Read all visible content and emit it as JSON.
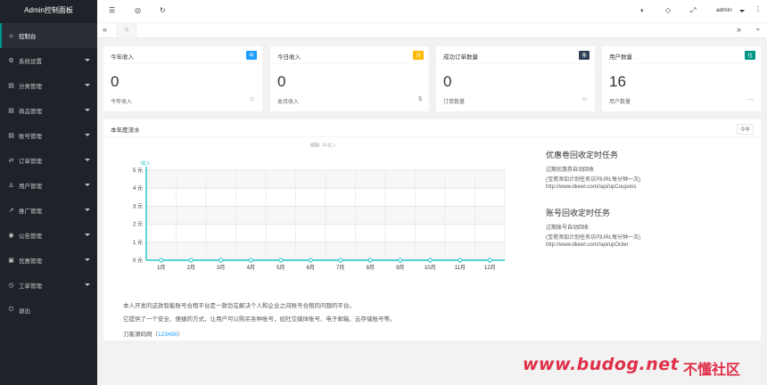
{
  "app_title": "Admin控制面板",
  "sidebar": {
    "items": [
      {
        "icon": "⌂",
        "label": "控制台",
        "caret": false
      },
      {
        "icon": "⚙",
        "label": "系统设置",
        "caret": true
      },
      {
        "icon": "▤",
        "label": "分类管理",
        "caret": true
      },
      {
        "icon": "▤",
        "label": "商品管理",
        "caret": true
      },
      {
        "icon": "▤",
        "label": "账号管理",
        "caret": true
      },
      {
        "icon": "⇄",
        "label": "订单管理",
        "caret": true
      },
      {
        "icon": "♙",
        "label": "用户管理",
        "caret": true
      },
      {
        "icon": "↗",
        "label": "推广管理",
        "caret": true
      },
      {
        "icon": "◉",
        "label": "公告管理",
        "caret": true
      },
      {
        "icon": "▣",
        "label": "优惠管理",
        "caret": true
      },
      {
        "icon": "◷",
        "label": "工单管理",
        "caret": true
      },
      {
        "icon": "⏻",
        "label": "退出",
        "caret": false
      }
    ]
  },
  "header": {
    "icons": [
      "menu-fold-icon",
      "globe-icon",
      "refresh-icon",
      "theme-icon",
      "tag-icon",
      "fullscreen-icon"
    ],
    "user": "admin",
    "more": "⋮"
  },
  "tabs": {
    "prev": "«",
    "next": "»",
    "dropdown": "⌄",
    "home_icon": "⌂"
  },
  "cards": [
    {
      "title": "今年收入",
      "badge": "年",
      "badge_color": "#1e9fff",
      "value": "0",
      "sub": "今年收入",
      "icon": "⚐"
    },
    {
      "title": "今日收入",
      "badge": "月",
      "badge_color": "#ffb800",
      "value": "0",
      "sub": "本月收入",
      "icon": "$"
    },
    {
      "title": "成功订单数量",
      "badge": "条",
      "badge_color": "#2f4056",
      "value": "0",
      "sub": "订单数量",
      "icon": "☺"
    },
    {
      "title": "用户数量",
      "badge": "位",
      "badge_color": "#009688",
      "value": "16",
      "sub": "用户数量",
      "icon": "⋯"
    }
  ],
  "panel": {
    "title": "本年度流水",
    "year_button": "今年"
  },
  "chart_data": {
    "type": "line",
    "legend": "年收入",
    "series_label": "收入",
    "categories": [
      "1月",
      "2月",
      "3月",
      "4月",
      "5月",
      "6月",
      "7月",
      "8月",
      "9月",
      "10月",
      "11月",
      "12月"
    ],
    "values": [
      0,
      0,
      0,
      0,
      0,
      0,
      0,
      0,
      0,
      0,
      0,
      0
    ],
    "yticks": [
      "0 元",
      "1 元",
      "2 元",
      "3 元",
      "4 元",
      "5 元"
    ],
    "ylim": [
      0,
      5
    ],
    "color": "#2ec7c9"
  },
  "tasks": [
    {
      "title": "优惠卷回收定时任务",
      "lines": [
        "过期优惠券自动回收",
        "(宝塔添加计划任务访问URL每分钟一次)",
        "http://www.dkewl.com//api/upCoupons"
      ]
    },
    {
      "title": "账号回收定时任务",
      "lines": [
        "过期账号自动回收",
        "(宝塔添加计划任务访问URL每分钟一次)",
        "http://www.dkewl.com//api/upOrder"
      ]
    }
  ],
  "description": {
    "line1": "本人开发的这款智能账号合租平台是一款旨在解决个人和企业之间账号合租的问题的平台。",
    "line2": "它提供了一个安全、便捷的方式，让用户可以购买各种账号，如社交媒体账号、电子邮箱、云存储账号等。",
    "line3_prefix": "刀客源码网（",
    "line3_link": "123456",
    "line3_suffix": "）"
  },
  "watermark": {
    "text": "www.budog.net",
    "cn": "不懂社区"
  }
}
